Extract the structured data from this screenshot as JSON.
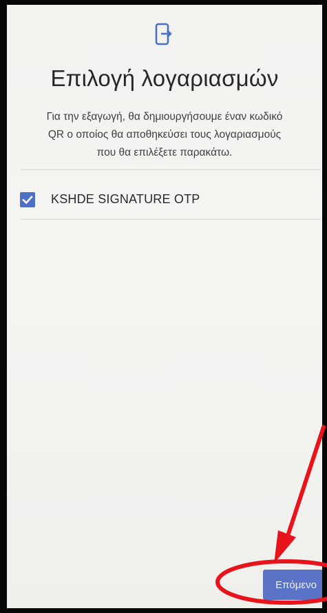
{
  "header": {
    "icon": "export-icon",
    "title": "Επιλογή λογαριασμών"
  },
  "description": {
    "line1": "Για την εξαγωγή, θα δημιουργήσουμε έναν κωδικό",
    "line2": "QR ο οποίος θα αποθηκεύσει τους λογαριασμούς",
    "line3": "που θα επιλέξετε παρακάτω."
  },
  "accounts": [
    {
      "label": "KSHDE SIGNATURE OTP",
      "checked": true
    }
  ],
  "footer": {
    "next_label": "Επόμενο"
  },
  "annotation": {
    "color": "#e8141c",
    "shapes": [
      "arrow",
      "ellipse"
    ]
  },
  "colors": {
    "accent": "#4c70c6",
    "button": "#5b73c6",
    "background": "#f3f3f0"
  }
}
